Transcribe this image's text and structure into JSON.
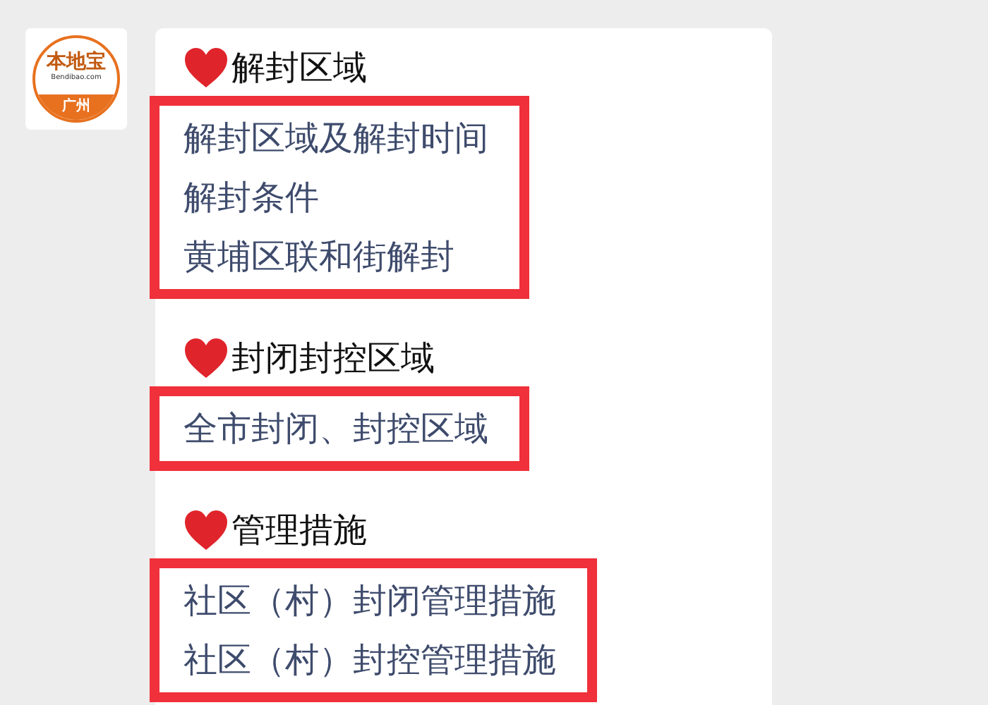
{
  "avatar": {
    "brand": "本地宝",
    "site": "Bendibao.com",
    "city": "广州"
  },
  "sections": [
    {
      "heading": "解封区域",
      "links": [
        "解封区域及解封时间",
        "解封条件",
        "黄埔区联和街解封"
      ]
    },
    {
      "heading": "封闭封控区域",
      "links": [
        "全市封闭、封控区域"
      ]
    },
    {
      "heading": "管理措施",
      "links": [
        "社区（村）封闭管理措施",
        "社区（村）封控管理措施"
      ]
    }
  ]
}
